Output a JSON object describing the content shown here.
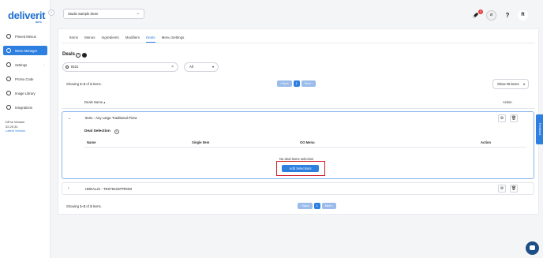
{
  "sidebar": {
    "logo": "deliverit",
    "logo_sub": "BETA",
    "collapse_icon": "chevron-left-icon",
    "items": [
      {
        "label": "Pinned Menus",
        "icon": "pin-icon"
      },
      {
        "label": "Menu Manager",
        "icon": "menu-book-icon",
        "active": true
      },
      {
        "label": "Settings",
        "icon": "gear-icon",
        "expandable": true
      },
      {
        "label": "Promo Code",
        "icon": "ticket-icon"
      },
      {
        "label": "Image Library",
        "icon": "image-icon"
      },
      {
        "label": "Integrations",
        "icon": "link-icon"
      }
    ],
    "version_label": "DPos Version",
    "version_number": "02.20.31",
    "latest_version": "Latest Version"
  },
  "topbar": {
    "store": "Studio Sample Store",
    "notification_count": "3",
    "help_icon": "?",
    "avatar": "R"
  },
  "tabs": [
    "Items",
    "Menus",
    "Ingredients",
    "Modifiers",
    "Deals",
    "Menu Settings"
  ],
  "active_tab": "Deals",
  "page_title": "Deals",
  "search": {
    "value": "8101",
    "clear": "×"
  },
  "filter": {
    "value": "All"
  },
  "pagination_top": {
    "showing_prefix": "Showing ",
    "range": "1–2",
    "of": " of ",
    "total": "2",
    "suffix": " items.",
    "back": "‹ Back",
    "page": "1",
    "next": "Next ›"
  },
  "per_page": "Show 25 items",
  "table": {
    "header_name": "Deals Name ▴",
    "header_action": "Action"
  },
  "deals": [
    {
      "name": "8101 - Any Large Traditional Pizza",
      "expanded": true,
      "sub_title": "Deal Selection",
      "sub_columns": [
        "Name",
        "Single Item",
        "OO Menu",
        "Action"
      ],
      "empty_text": "No deal items selection",
      "add_button": "Add Selections"
    },
    {
      "name": "HDEAL21 - TEST8101FPROM",
      "expanded": false
    }
  ],
  "pagination_bottom": {
    "showing_prefix": "Showing ",
    "range": "1–2",
    "of": " of ",
    "total": "2",
    "suffix": " items.",
    "back": "‹ Back",
    "page": "1",
    "next": "Next ›"
  },
  "feedback_label": "Feedback",
  "colors": {
    "accent": "#2d7fe0",
    "highlight": "#d3202a",
    "badge": "#e23b3b"
  }
}
